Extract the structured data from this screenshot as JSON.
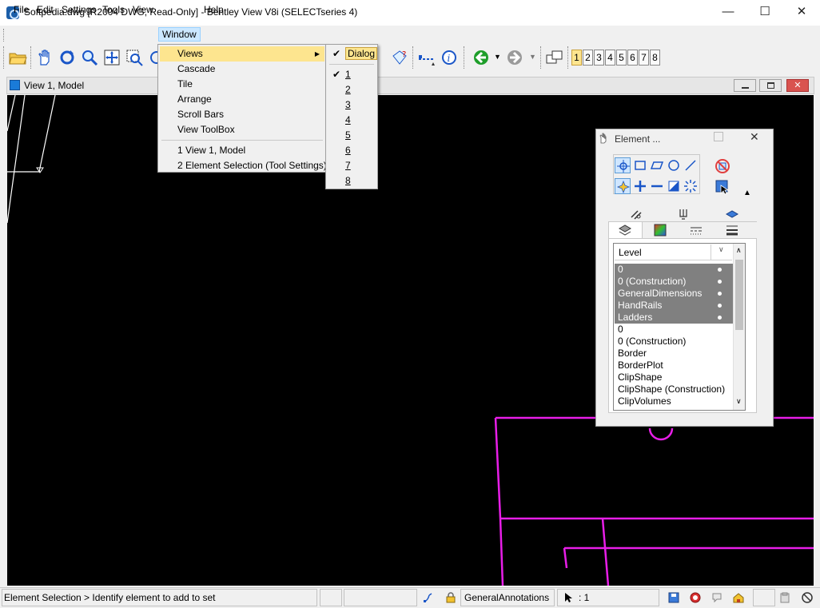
{
  "window": {
    "title": "Softpedia.dwg [R2004 DWG, Read-Only] - Bentley View V8i (SELECTseries 4)",
    "minimize": "—",
    "maximize": "☐",
    "close": "✕"
  },
  "menubar": {
    "file": "File",
    "edit": "Edit",
    "settings": "Settings",
    "tools": "Tools",
    "view": "View",
    "window": "Window",
    "help": "Help"
  },
  "window_menu": {
    "views": "Views",
    "cascade": "Cascade",
    "tile": "Tile",
    "arrange": "Arrange",
    "scroll_bars": "Scroll Bars",
    "view_toolbox": "View ToolBox",
    "recent": [
      {
        "num": "1",
        "label": "View 1, Model"
      },
      {
        "num": "2",
        "label": "Element Selection (Tool Settings)"
      }
    ]
  },
  "views_submenu": {
    "dialog": "Dialog",
    "items": [
      "1",
      "2",
      "3",
      "4",
      "5",
      "6",
      "7",
      "8"
    ],
    "checked": "1"
  },
  "toolbar": {
    "view_numbers": [
      "1",
      "2",
      "3",
      "4",
      "5",
      "6",
      "7",
      "8"
    ],
    "active_view": "1",
    "colors": {
      "back": "#1e9e2a",
      "forward": "#9a9a9a",
      "info": "#1a56c8"
    }
  },
  "view_window": {
    "title": "View 1, Model",
    "background": "#000000",
    "geometry_color": "#e81ee8"
  },
  "element_dialog": {
    "title": "Element ...",
    "level_header": "Level",
    "levels": [
      {
        "name": "0",
        "selected": true
      },
      {
        "name": "0 (Construction)",
        "selected": true
      },
      {
        "name": "GeneralDimensions",
        "selected": true
      },
      {
        "name": "HandRails",
        "selected": true
      },
      {
        "name": "Ladders",
        "selected": true
      },
      {
        "name": "0",
        "selected": false
      },
      {
        "name": "0 (Construction)",
        "selected": false
      },
      {
        "name": "Border",
        "selected": false
      },
      {
        "name": "BorderPlot",
        "selected": false
      },
      {
        "name": "ClipShape",
        "selected": false
      },
      {
        "name": "ClipShape (Construction)",
        "selected": false
      },
      {
        "name": "ClipVolumes",
        "selected": false
      }
    ]
  },
  "statusbar": {
    "message": "Element Selection > Identify element to add to set",
    "active_level": "GeneralAnnotations",
    "selection_count": ": 1"
  }
}
